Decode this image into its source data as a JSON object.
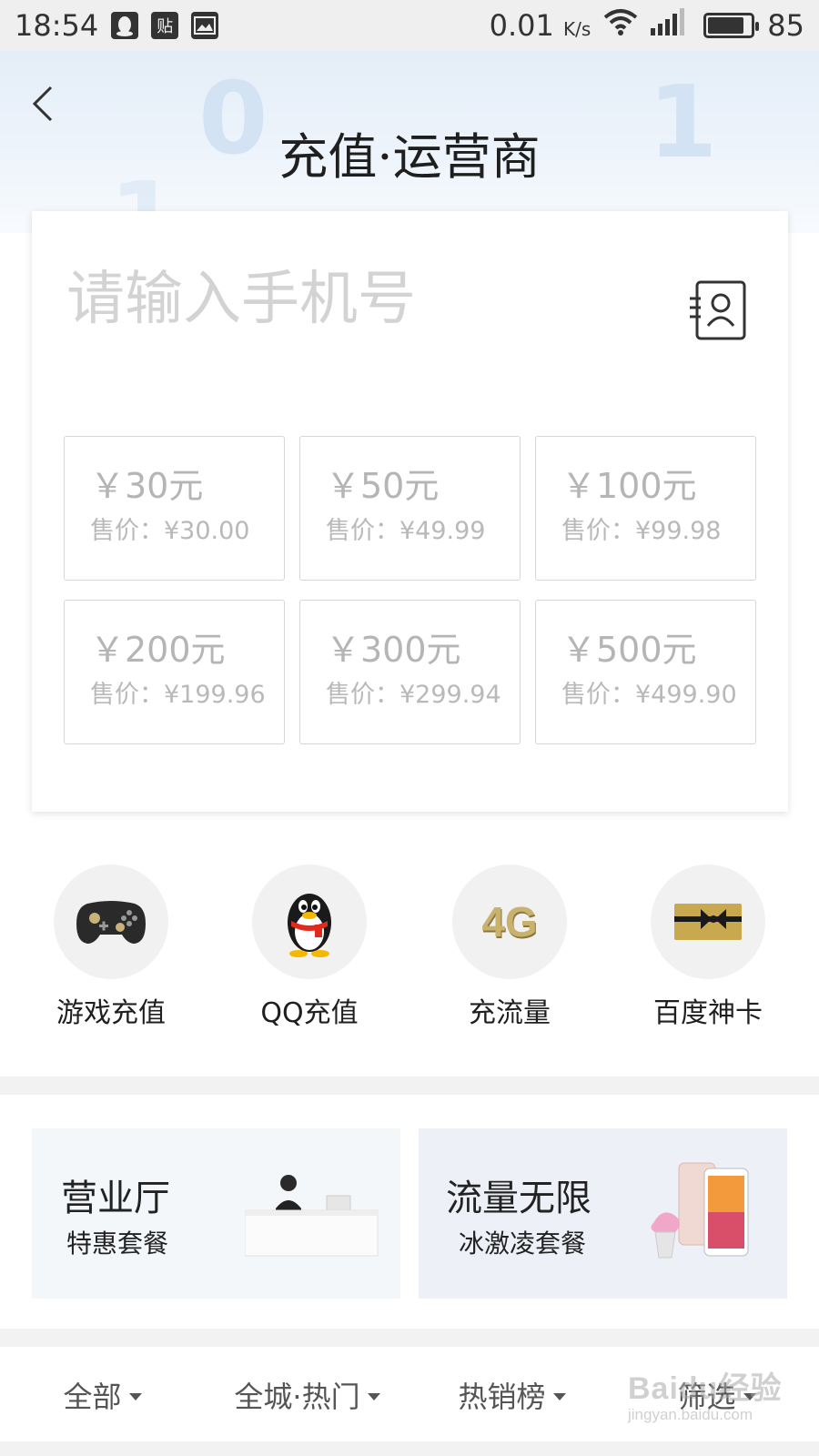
{
  "status_bar": {
    "time": "18:54",
    "notif_icons": [
      "qq-icon",
      "tieba-icon",
      "image-icon"
    ],
    "tieba_char": "贴",
    "net_speed": "0.01",
    "net_unit": "K/s",
    "battery": "85"
  },
  "header": {
    "title": "充值·运营商",
    "bg_digits": [
      "0",
      "1",
      "1"
    ]
  },
  "recharge": {
    "phone_placeholder": "请输入手机号",
    "amounts": [
      {
        "face": "￥30元",
        "price": "售价：¥30.00"
      },
      {
        "face": "￥50元",
        "price": "售价：¥49.99"
      },
      {
        "face": "￥100元",
        "price": "售价：¥99.98"
      },
      {
        "face": "￥200元",
        "price": "售价：¥199.96"
      },
      {
        "face": "￥300元",
        "price": "售价：¥299.94"
      },
      {
        "face": "￥500元",
        "price": "售价：¥499.90"
      }
    ]
  },
  "services": [
    {
      "label": "游戏充值",
      "icon": "gamepad-icon"
    },
    {
      "label": "QQ充值",
      "icon": "qq-penguin-icon"
    },
    {
      "label": "充流量",
      "icon": "4g-icon",
      "icon_text": "4G"
    },
    {
      "label": "百度神卡",
      "icon": "gift-card-icon"
    }
  ],
  "promos": [
    {
      "title": "营业厅",
      "subtitle": "特惠套餐",
      "bg": "#f3f7fa"
    },
    {
      "title": "流量无限",
      "subtitle": "冰激凌套餐",
      "bg": "#eef0f8"
    }
  ],
  "filters": [
    {
      "label": "全部"
    },
    {
      "label": "全城·热门"
    },
    {
      "label": "热销榜"
    },
    {
      "label": "筛选"
    }
  ],
  "watermark": {
    "main": "Baidu经验",
    "sub": "jingyan.baidu.com"
  }
}
